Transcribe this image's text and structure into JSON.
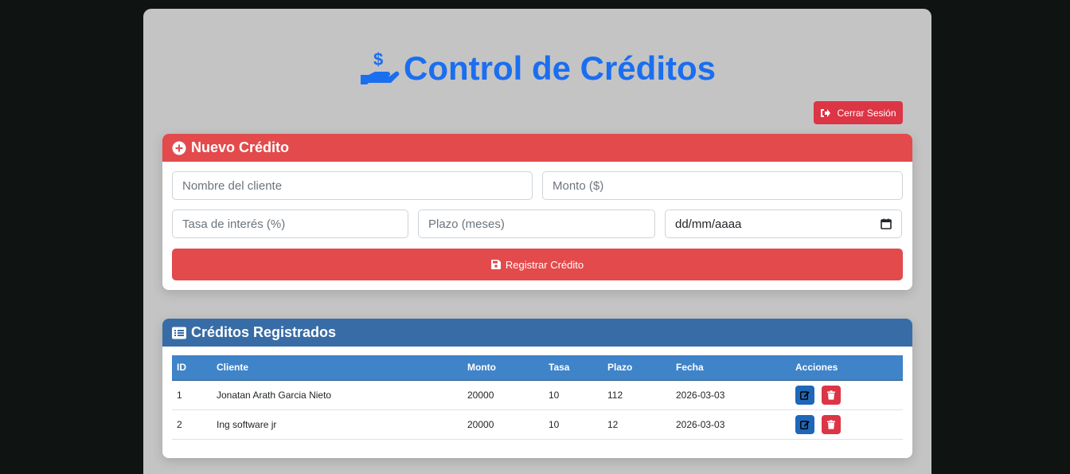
{
  "header": {
    "title": "Control de Créditos",
    "icon": "hand-holding-dollar-icon"
  },
  "logout": {
    "label": "Cerrar Sesión",
    "icon": "sign-out-icon"
  },
  "form": {
    "title": "Nuevo Crédito",
    "client_placeholder": "Nombre del cliente",
    "amount_placeholder": "Monto ($)",
    "rate_placeholder": "Tasa de interés (%)",
    "term_placeholder": "Plazo (meses)",
    "date_placeholder": "dd/mm/aaaa",
    "submit_label": "Registrar Crédito"
  },
  "list": {
    "title": "Créditos Registrados",
    "columns": [
      "ID",
      "Cliente",
      "Monto",
      "Tasa",
      "Plazo",
      "Fecha",
      "Acciones"
    ],
    "rows": [
      {
        "id": "1",
        "client": "Jonatan Arath Garcia Nieto",
        "amount": "20000",
        "rate": "10",
        "term": "112",
        "date": "2026-03-03"
      },
      {
        "id": "2",
        "client": "Ing software jr",
        "amount": "20000",
        "rate": "10",
        "term": "12",
        "date": "2026-03-03"
      }
    ]
  },
  "colors": {
    "primary_blue": "#1a6ef0",
    "danger_red": "#dc3545",
    "form_header": "#e34a4c",
    "list_header": "#386ca6"
  }
}
